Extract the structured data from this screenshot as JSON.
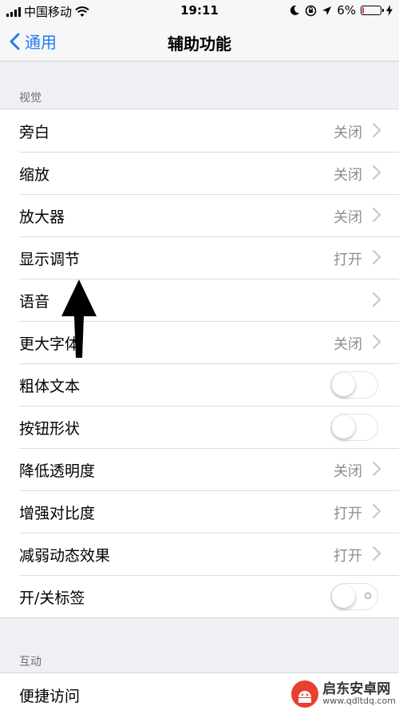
{
  "status_bar": {
    "carrier": "中国移动",
    "time": "19:11",
    "battery": "6%",
    "battery_level": 0.06
  },
  "nav": {
    "back_label": "通用",
    "title": "辅助功能"
  },
  "sections": {
    "vision": {
      "header": "视觉",
      "rows": [
        {
          "label": "旁白",
          "value": "关闭"
        },
        {
          "label": "缩放",
          "value": "关闭"
        },
        {
          "label": "放大器",
          "value": "关闭"
        },
        {
          "label": "显示调节",
          "value": "打开"
        },
        {
          "label": "语音",
          "value": ""
        },
        {
          "label": "更大字体",
          "value": "关闭"
        },
        {
          "label": "粗体文本",
          "toggle": false
        },
        {
          "label": "按钮形状",
          "toggle": false
        },
        {
          "label": "降低透明度",
          "value": "关闭"
        },
        {
          "label": "增强对比度",
          "value": "打开"
        },
        {
          "label": "减弱动态效果",
          "value": "打开"
        },
        {
          "label": "开/关标签",
          "toggle": false
        }
      ]
    },
    "interaction": {
      "header": "互动",
      "rows": [
        {
          "label": "便捷访问"
        }
      ]
    }
  },
  "watermark": {
    "title": "启东安卓网",
    "url": "www.qdltdq.com"
  },
  "colors": {
    "accent": "#1e7cf2",
    "battery_low": "#e53935",
    "background": "#efeff4",
    "secondary_text": "#8e8e93"
  }
}
